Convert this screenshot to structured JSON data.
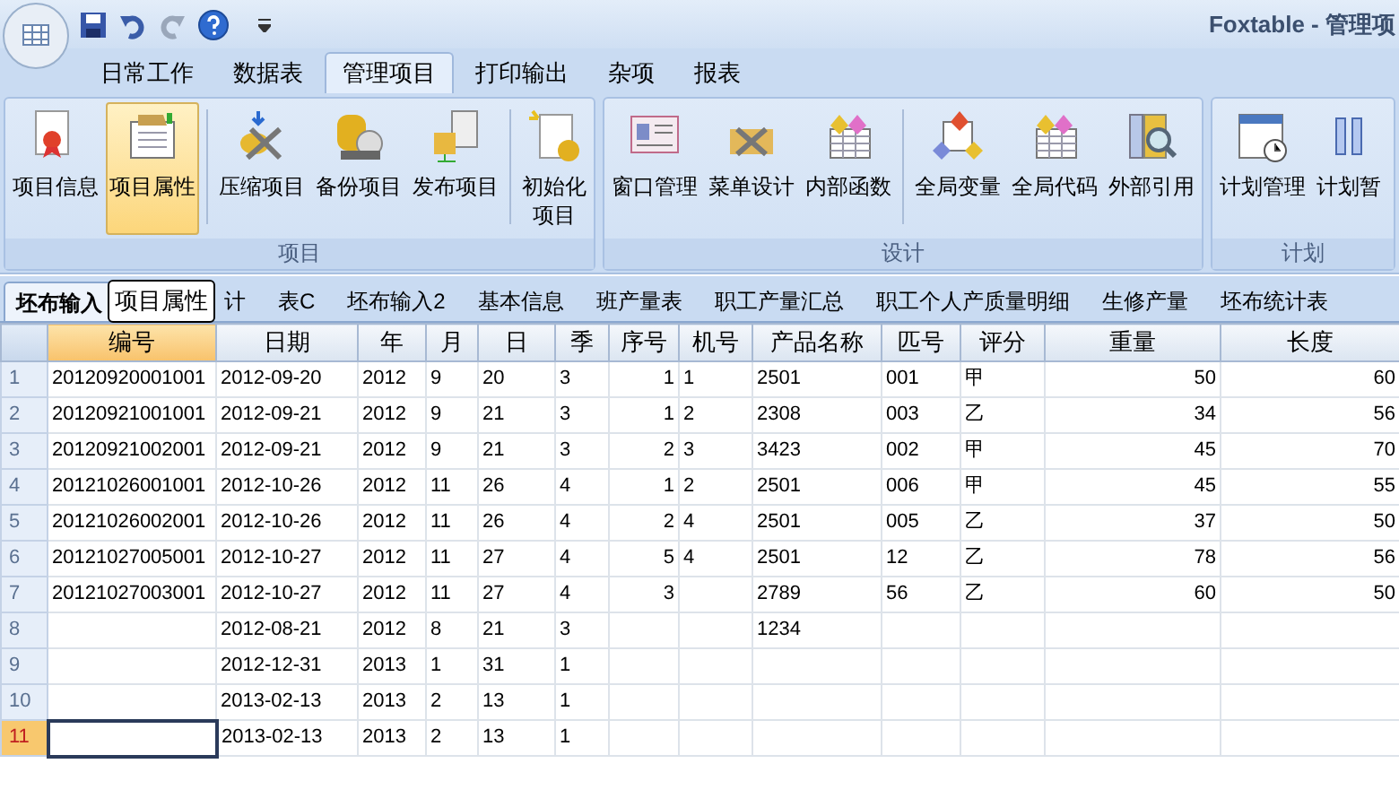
{
  "window": {
    "title": "Foxtable - 管理项"
  },
  "ribbon_tabs": [
    {
      "label": "日常工作",
      "selected": false
    },
    {
      "label": "数据表",
      "selected": false
    },
    {
      "label": "管理项目",
      "selected": true
    },
    {
      "label": "打印输出",
      "selected": false
    },
    {
      "label": "杂项",
      "selected": false
    },
    {
      "label": "报表",
      "selected": false
    }
  ],
  "ribbon_groups": [
    {
      "label": "项目",
      "buttons": [
        {
          "label": "项目信息",
          "selected": false
        },
        {
          "label": "项目属性",
          "selected": true,
          "separator_after": true
        },
        {
          "label": "压缩项目",
          "selected": false
        },
        {
          "label": "备份项目",
          "selected": false
        },
        {
          "label": "发布项目",
          "selected": false,
          "separator_after": true
        },
        {
          "label": "初始化项目",
          "selected": false
        }
      ]
    },
    {
      "label": "设计",
      "buttons": [
        {
          "label": "窗口管理",
          "selected": false
        },
        {
          "label": "菜单设计",
          "selected": false
        },
        {
          "label": "内部函数",
          "selected": false,
          "separator_after": true
        },
        {
          "label": "全局变量",
          "selected": false
        },
        {
          "label": "全局代码",
          "selected": false
        },
        {
          "label": "外部引用",
          "selected": false
        }
      ]
    },
    {
      "label": "计划",
      "buttons": [
        {
          "label": "计划管理",
          "selected": false
        },
        {
          "label": "计划暂",
          "selected": false
        }
      ]
    }
  ],
  "tooltip": "项目属性",
  "sheet_tabs": [
    {
      "label": "坯布输入",
      "selected": true
    },
    {
      "label": "计",
      "selected": false
    },
    {
      "label": "表C",
      "selected": false
    },
    {
      "label": "坯布输入2",
      "selected": false
    },
    {
      "label": "基本信息",
      "selected": false
    },
    {
      "label": "班产量表",
      "selected": false
    },
    {
      "label": "职工产量汇总",
      "selected": false
    },
    {
      "label": "职工个人产质量明细",
      "selected": false
    },
    {
      "label": "生修产量",
      "selected": false
    },
    {
      "label": "坯布统计表",
      "selected": false
    }
  ],
  "table": {
    "columns": [
      {
        "label": "编号",
        "kind": "text",
        "selected": true
      },
      {
        "label": "日期",
        "kind": "text",
        "selected": false
      },
      {
        "label": "年",
        "kind": "text",
        "selected": false
      },
      {
        "label": "月",
        "kind": "text",
        "selected": false
      },
      {
        "label": "日",
        "kind": "text",
        "selected": false
      },
      {
        "label": "季",
        "kind": "text",
        "selected": false
      },
      {
        "label": "序号",
        "kind": "number",
        "selected": false
      },
      {
        "label": "机号",
        "kind": "text",
        "selected": false
      },
      {
        "label": "产品名称",
        "kind": "text",
        "selected": false
      },
      {
        "label": "匹号",
        "kind": "text",
        "selected": false
      },
      {
        "label": "评分",
        "kind": "text",
        "selected": false
      },
      {
        "label": "重量",
        "kind": "number",
        "selected": false
      },
      {
        "label": "长度",
        "kind": "number",
        "selected": false
      }
    ],
    "rows": [
      {
        "number": "1",
        "selected": false,
        "cells": [
          "20120920001001",
          "2012-09-20",
          "2012",
          "9",
          "20",
          "3",
          "1",
          "1",
          "2501",
          "001",
          "甲",
          "50",
          "60"
        ]
      },
      {
        "number": "2",
        "selected": false,
        "cells": [
          "20120921001001",
          "2012-09-21",
          "2012",
          "9",
          "21",
          "3",
          "1",
          "2",
          "2308",
          "003",
          "乙",
          "34",
          "56"
        ]
      },
      {
        "number": "3",
        "selected": false,
        "cells": [
          "20120921002001",
          "2012-09-21",
          "2012",
          "9",
          "21",
          "3",
          "2",
          "3",
          "3423",
          "002",
          "甲",
          "45",
          "70"
        ]
      },
      {
        "number": "4",
        "selected": false,
        "cells": [
          "20121026001001",
          "2012-10-26",
          "2012",
          "11",
          "26",
          "4",
          "1",
          "2",
          "2501",
          "006",
          "甲",
          "45",
          "55"
        ]
      },
      {
        "number": "5",
        "selected": false,
        "cells": [
          "20121026002001",
          "2012-10-26",
          "2012",
          "11",
          "26",
          "4",
          "2",
          "4",
          "2501",
          "005",
          "乙",
          "37",
          "50"
        ]
      },
      {
        "number": "6",
        "selected": false,
        "cells": [
          "20121027005001",
          "2012-10-27",
          "2012",
          "11",
          "27",
          "4",
          "5",
          "4",
          "2501",
          "12",
          "乙",
          "78",
          "56"
        ]
      },
      {
        "number": "7",
        "selected": false,
        "cells": [
          "20121027003001",
          "2012-10-27",
          "2012",
          "11",
          "27",
          "4",
          "3",
          "",
          "2789",
          "56",
          "乙",
          "60",
          "50"
        ]
      },
      {
        "number": "8",
        "selected": false,
        "cells": [
          "",
          "2012-08-21",
          "2012",
          "8",
          "21",
          "3",
          "",
          "",
          "1234",
          "",
          "",
          "",
          ""
        ]
      },
      {
        "number": "9",
        "selected": false,
        "cells": [
          "",
          "2012-12-31",
          "2013",
          "1",
          "31",
          "1",
          "",
          "",
          "",
          "",
          "",
          "",
          ""
        ]
      },
      {
        "number": "10",
        "selected": false,
        "cells": [
          "",
          "2013-02-13",
          "2013",
          "2",
          "13",
          "1",
          "",
          "",
          "",
          "",
          "",
          "",
          ""
        ]
      },
      {
        "number": "11",
        "selected": true,
        "cells": [
          "",
          "2013-02-13",
          "2013",
          "2",
          "13",
          "1",
          "",
          "",
          "",
          "",
          "",
          "",
          ""
        ]
      }
    ]
  }
}
